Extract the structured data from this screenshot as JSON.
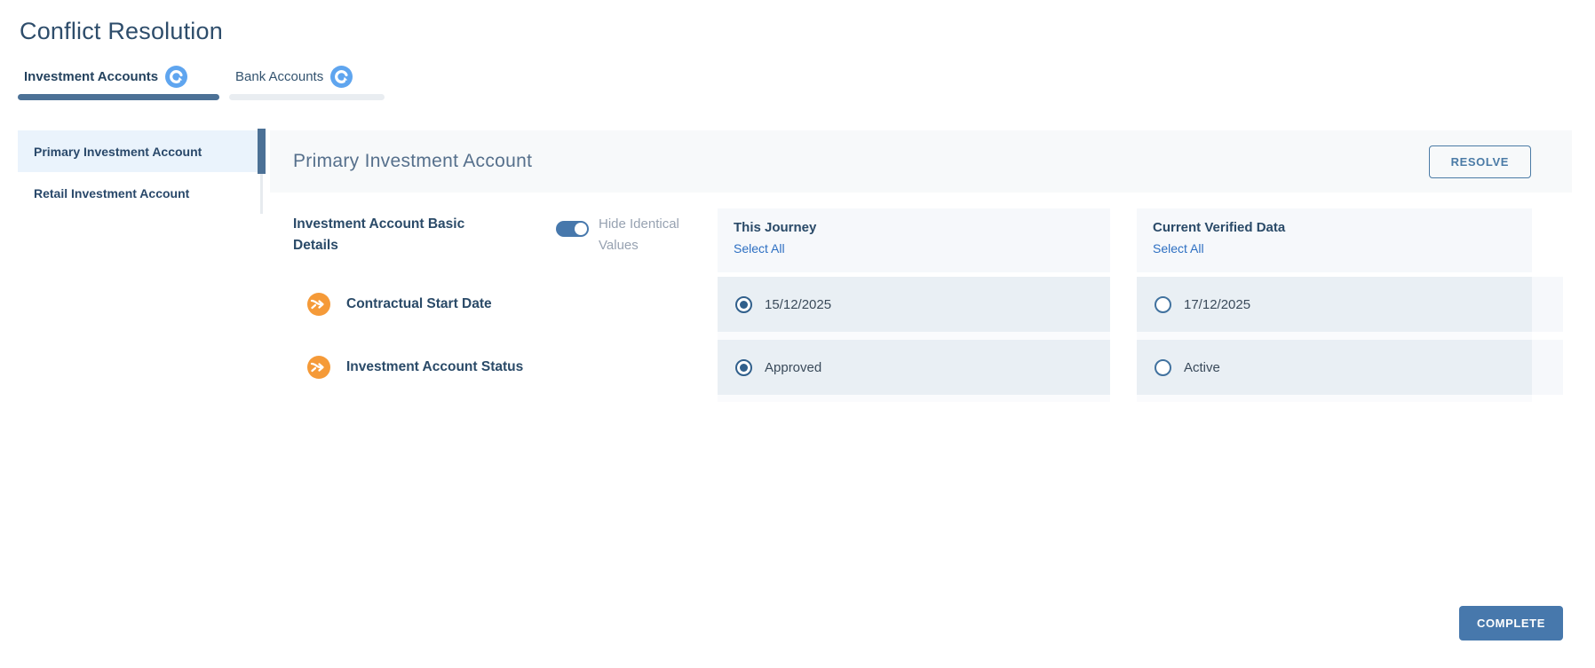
{
  "page": {
    "title": "Conflict Resolution"
  },
  "tabs": [
    {
      "label": "Investment Accounts",
      "active": true
    },
    {
      "label": "Bank Accounts",
      "active": false
    }
  ],
  "sidebar": {
    "items": [
      {
        "label": "Primary Investment Account",
        "selected": true
      },
      {
        "label": "Retail Investment Account",
        "selected": false
      }
    ]
  },
  "panel": {
    "title": "Primary Investment Account",
    "resolve_label": "RESOLVE",
    "complete_label": "COMPLETE"
  },
  "section": {
    "title": "Investment Account Basic Details",
    "toggle": {
      "label": "Hide Identical Values",
      "on": true
    }
  },
  "columns": {
    "journey": {
      "title": "This Journey",
      "select_all": "Select All"
    },
    "verified": {
      "title": "Current Verified Data",
      "select_all": "Select All"
    }
  },
  "rows": [
    {
      "label": "Contractual Start Date",
      "journey": {
        "value": "15/12/2025",
        "selected": true
      },
      "verified": {
        "value": "17/12/2025",
        "selected": false
      }
    },
    {
      "label": "Investment Account Status",
      "journey": {
        "value": "Approved",
        "selected": true
      },
      "verified": {
        "value": "Active",
        "selected": false
      }
    }
  ],
  "colors": {
    "accent": "#4778ac",
    "active_tab_bar": "#4c7196",
    "link": "#2d6fc2",
    "heading": "#2a4a68",
    "tab_icon_blue": "#5fa5ef",
    "row_bg": "#e9eff4",
    "column_header_bg": "#f6f8fb",
    "selected_item_bg": "#eaf3fc",
    "merge_icon_orange": "#f59a38"
  }
}
